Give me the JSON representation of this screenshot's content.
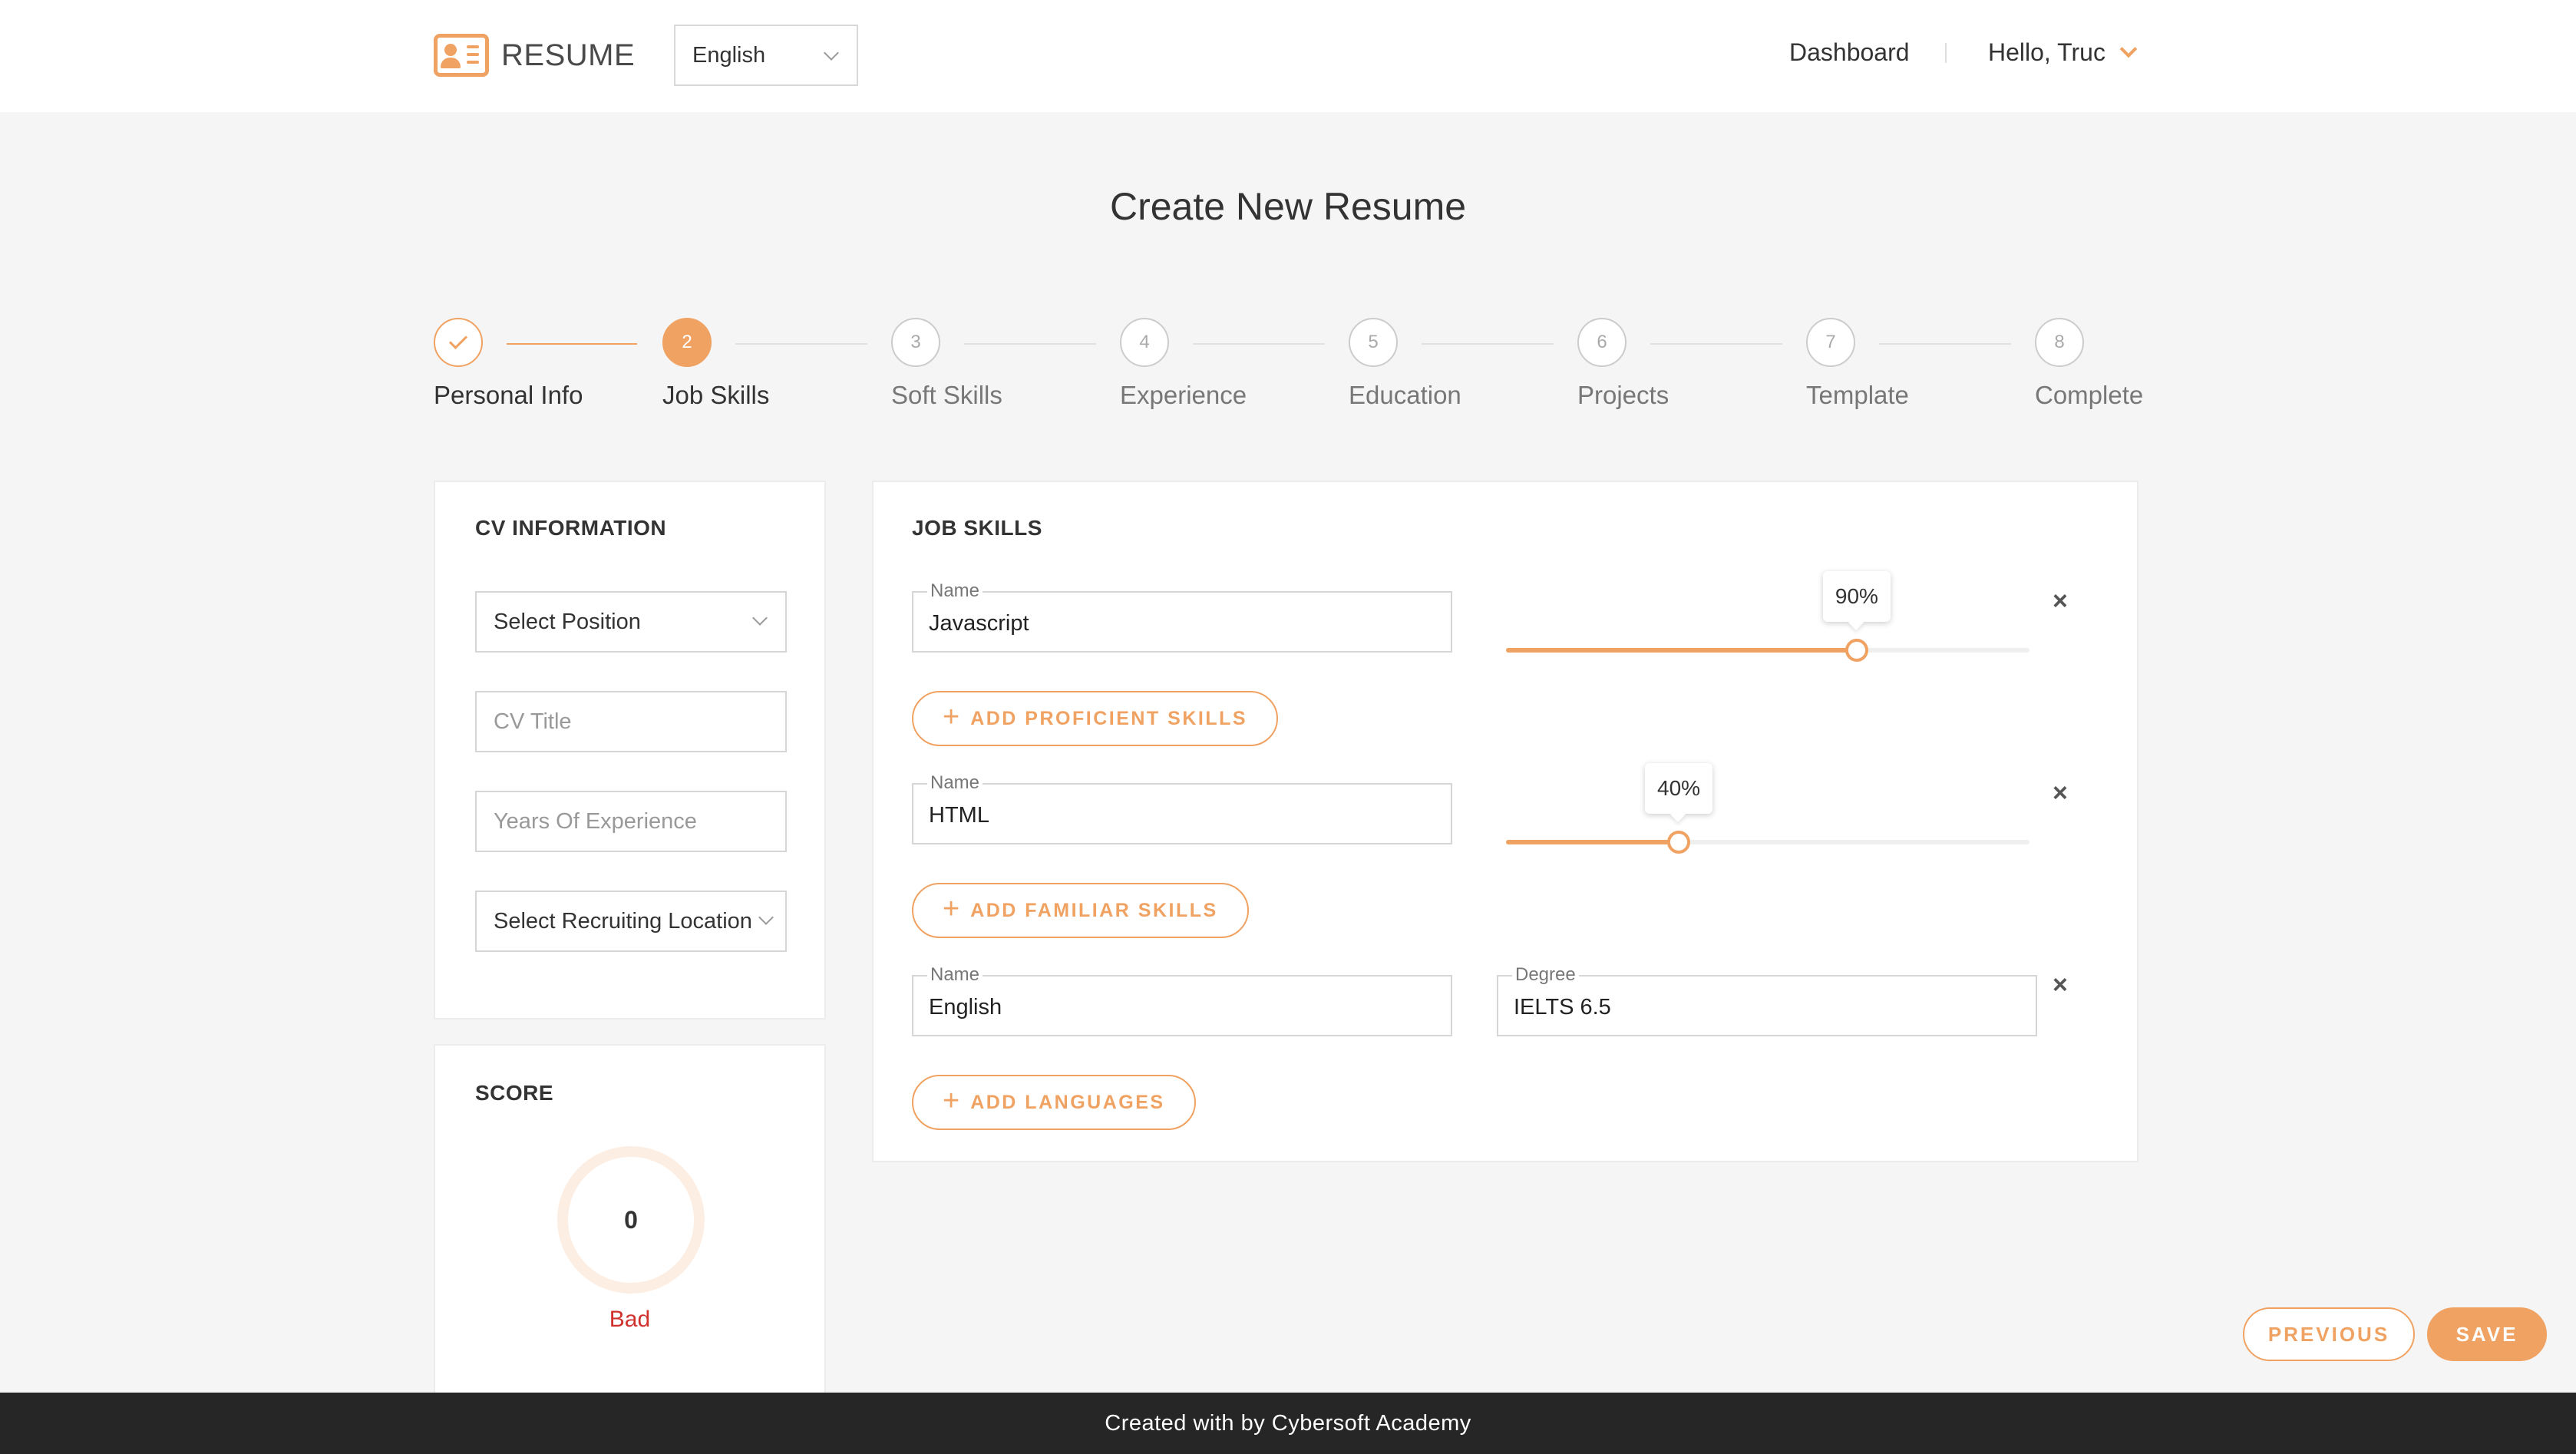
{
  "header": {
    "logo_text": "RESUME",
    "language": "English",
    "nav_dashboard": "Dashboard",
    "greeting": "Hello, Truc"
  },
  "page_title": "Create New Resume",
  "steps": [
    {
      "number": "",
      "label": "Personal Info",
      "state": "done"
    },
    {
      "number": "2",
      "label": "Job Skills",
      "state": "active"
    },
    {
      "number": "3",
      "label": "Soft Skills",
      "state": "pending"
    },
    {
      "number": "4",
      "label": "Experience",
      "state": "pending"
    },
    {
      "number": "5",
      "label": "Education",
      "state": "pending"
    },
    {
      "number": "6",
      "label": "Projects",
      "state": "pending"
    },
    {
      "number": "7",
      "label": "Template",
      "state": "pending"
    },
    {
      "number": "8",
      "label": "Complete",
      "state": "pending"
    }
  ],
  "cv_info": {
    "title": "CV INFORMATION",
    "position": "Select Position",
    "cv_title_placeholder": "CV Title",
    "years_placeholder": "Years Of Experience",
    "location": "Select Recruiting Location"
  },
  "score": {
    "title": "SCORE",
    "value": "0",
    "rating": "Bad"
  },
  "job_skills": {
    "title": "JOB SKILLS",
    "proficient": {
      "name_label": "Name",
      "name_value": "Javascript",
      "level_label": "90%",
      "level": 0.9
    },
    "add_proficient": "ADD PROFICIENT SKILLS",
    "familiar": {
      "name_label": "Name",
      "name_value": "HTML",
      "level_label": "40%",
      "level": 0.4
    },
    "add_familiar": "ADD FAMILIAR SKILLS",
    "language": {
      "name_label": "Name",
      "name_value": "English",
      "degree_label": "Degree",
      "degree_value": "IELTS 6.5"
    },
    "add_languages": "ADD LANGUAGES",
    "remove": "×",
    "plus": "+"
  },
  "buttons": {
    "previous": "PREVIOUS",
    "save": "SAVE"
  },
  "footer": "Created with by Cybersoft Academy",
  "colors": {
    "accent": "#f0a262",
    "bad": "#d0312d",
    "footer_bg": "#262626"
  },
  "icons": {
    "logo": "resume-card-icon",
    "language_dropdown": "chevron-down-icon",
    "user_menu": "chevron-down-icon",
    "step_done": "check-icon",
    "remove": "close-icon",
    "add": "plus-icon"
  }
}
